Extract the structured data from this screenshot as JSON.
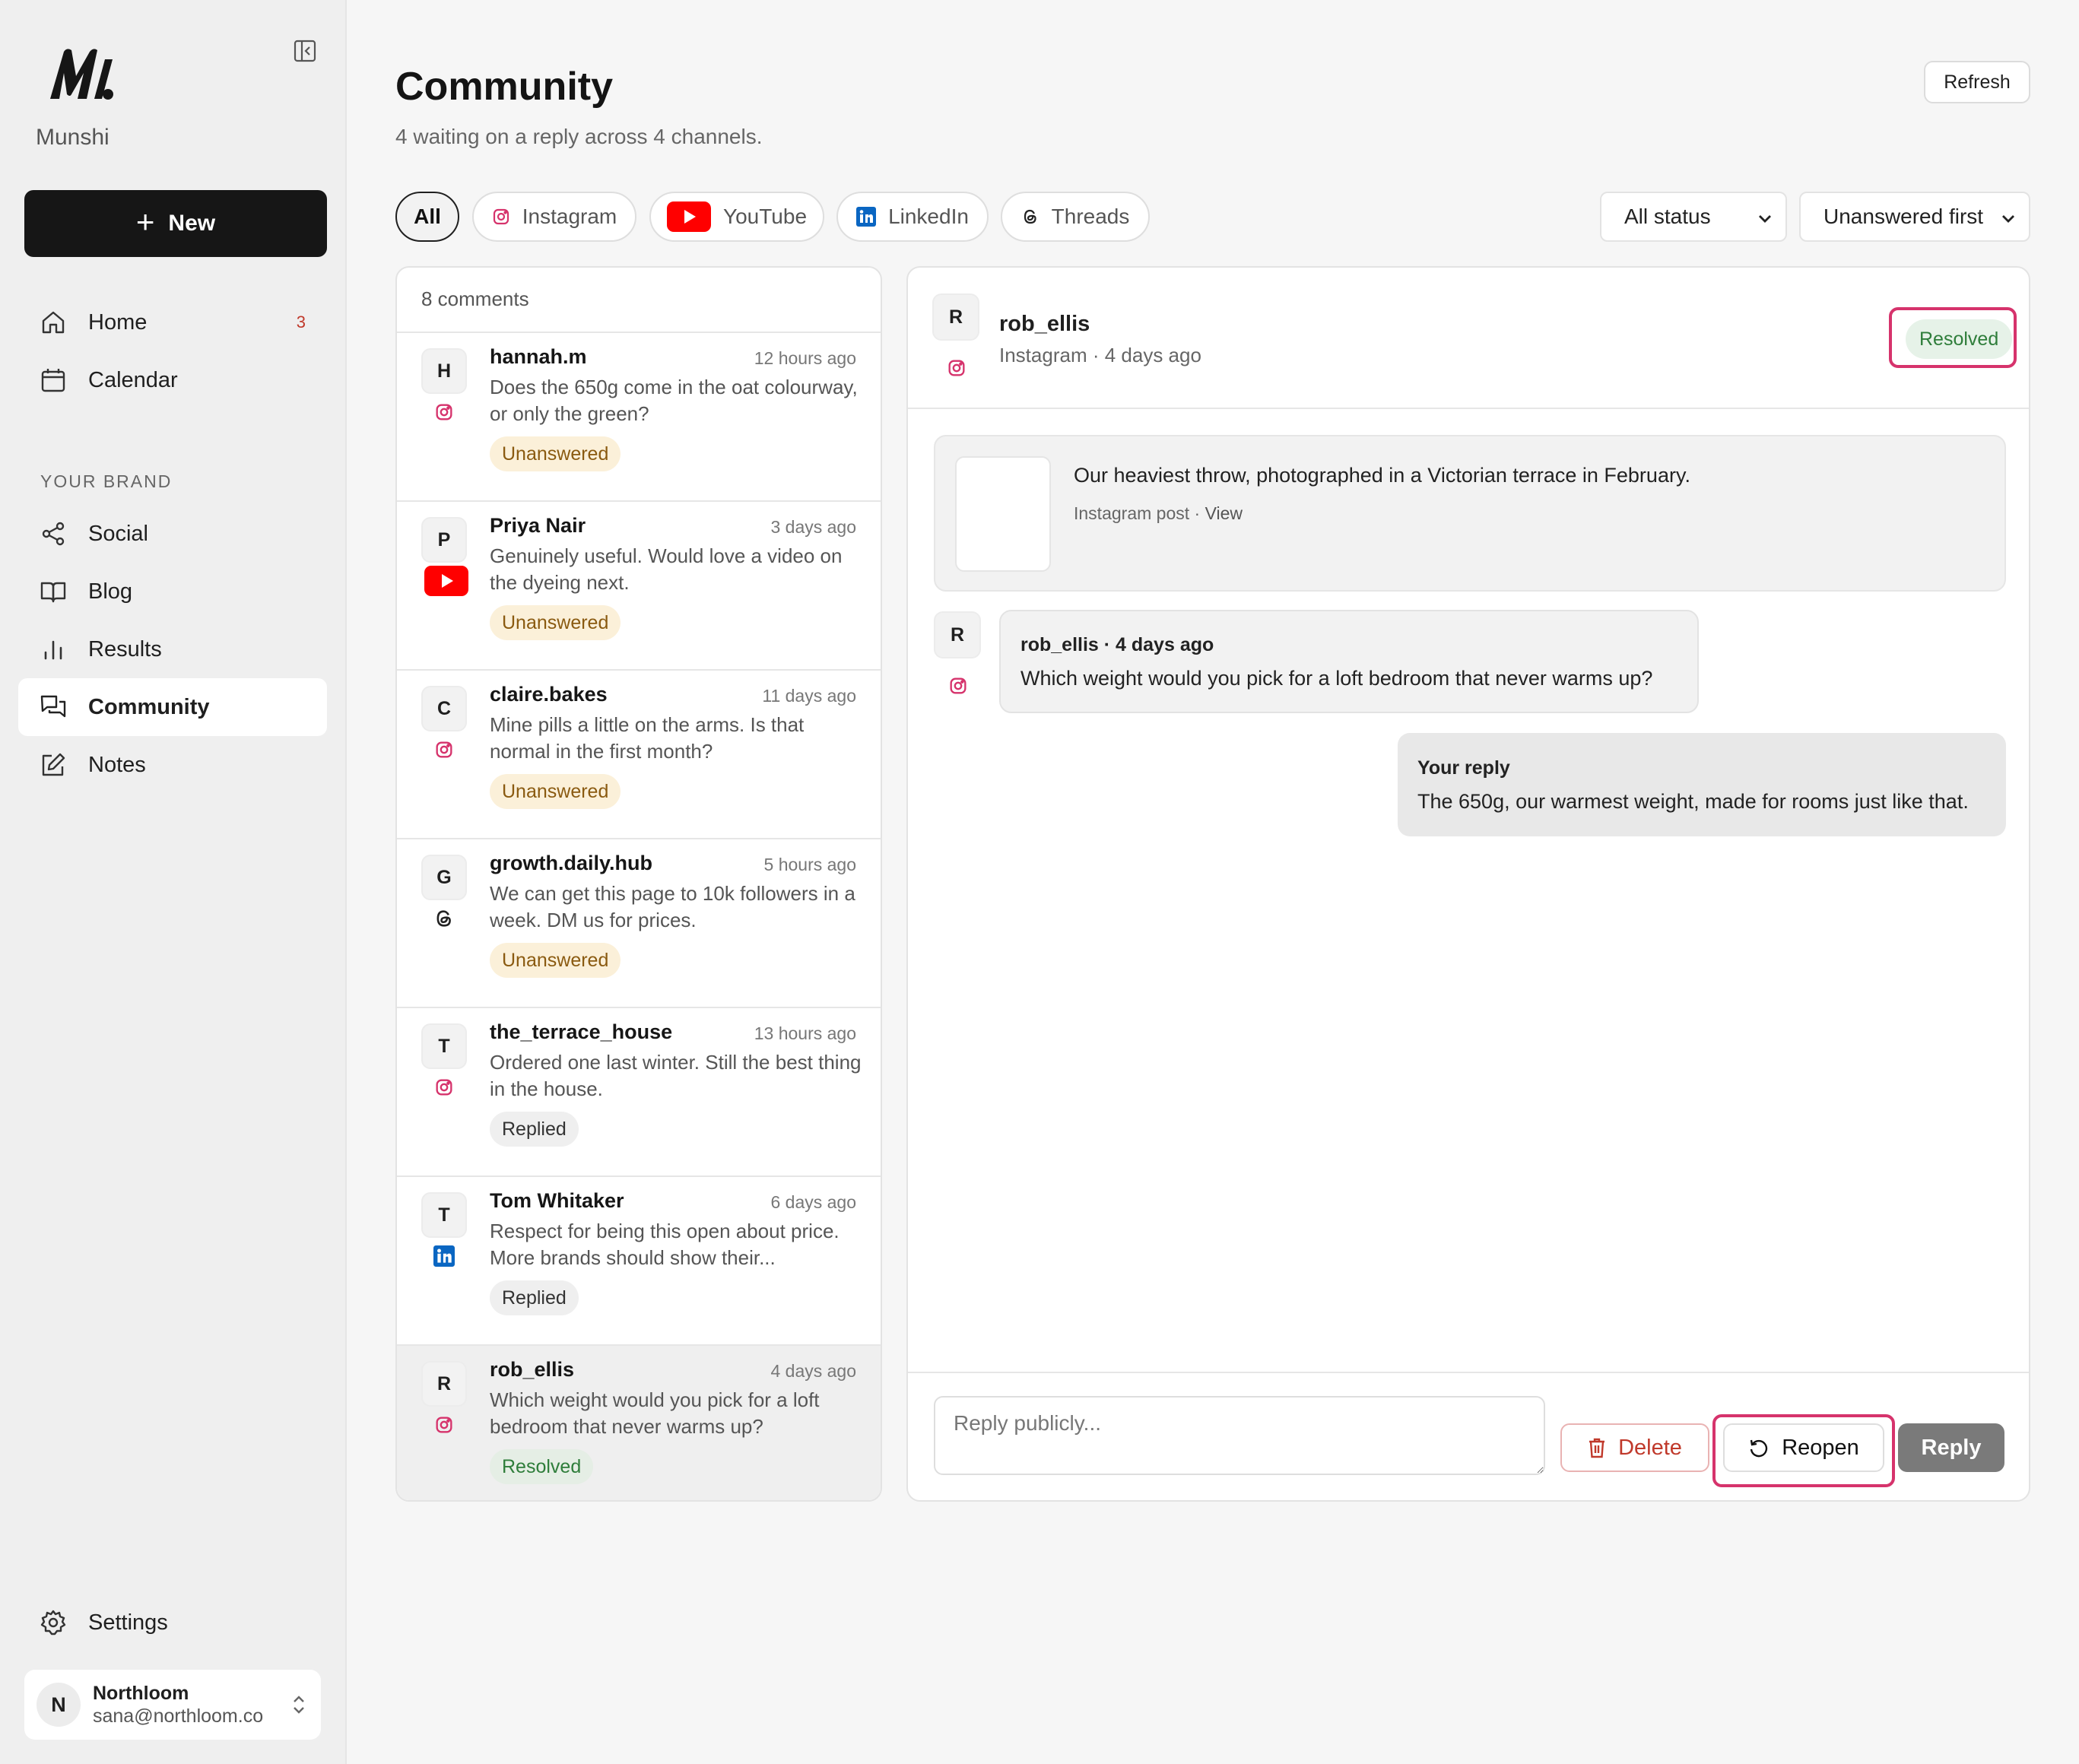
{
  "app": {
    "name": "Munshi",
    "new_label": "New"
  },
  "sidebar": {
    "items": [
      {
        "label": "Home",
        "icon": "home-icon",
        "badge": "3"
      },
      {
        "label": "Calendar",
        "icon": "calendar-icon"
      },
      {
        "label": "Social",
        "icon": "share-icon"
      },
      {
        "label": "Blog",
        "icon": "book-icon"
      },
      {
        "label": "Results",
        "icon": "bar-chart-icon"
      },
      {
        "label": "Community",
        "icon": "chat-icon",
        "active": true
      },
      {
        "label": "Notes",
        "icon": "edit-icon"
      }
    ],
    "section_label": "YOUR BRAND",
    "settings_label": "Settings",
    "account": {
      "initial": "N",
      "name": "Northloom",
      "email": "sana@northloom.co"
    }
  },
  "header": {
    "title": "Community",
    "subtitle": "4 waiting on a reply across 4 channels.",
    "refresh_label": "Refresh"
  },
  "filters": {
    "channels": [
      {
        "label": "All",
        "active": true
      },
      {
        "label": "Instagram",
        "icon": "instagram-icon"
      },
      {
        "label": "YouTube",
        "icon": "youtube-icon"
      },
      {
        "label": "LinkedIn",
        "icon": "linkedin-icon"
      },
      {
        "label": "Threads",
        "icon": "threads-icon"
      }
    ],
    "status_select": "All status",
    "sort_select": "Unanswered first"
  },
  "list": {
    "count_label": "8 comments",
    "items": [
      {
        "initial": "H",
        "name": "hannah.m",
        "time": "12 hours ago",
        "text": "Does the 650g come in the oat colourway, or only the green?",
        "status": "Unanswered",
        "channel": "instagram"
      },
      {
        "initial": "P",
        "name": "Priya Nair",
        "time": "3 days ago",
        "text": "Genuinely useful. Would love a video on the dyeing next.",
        "status": "Unanswered",
        "channel": "youtube"
      },
      {
        "initial": "C",
        "name": "claire.bakes",
        "time": "11 days ago",
        "text": "Mine pills a little on the arms. Is that normal in the first month?",
        "status": "Unanswered",
        "channel": "instagram"
      },
      {
        "initial": "G",
        "name": "growth.daily.hub",
        "time": "5 hours ago",
        "text": "We can get this page to 10k followers in a week. DM us for prices.",
        "status": "Unanswered",
        "channel": "threads"
      },
      {
        "initial": "T",
        "name": "the_terrace_house",
        "time": "13 hours ago",
        "text": "Ordered one last winter. Still the best thing in the house.",
        "status": "Replied",
        "channel": "instagram"
      },
      {
        "initial": "T",
        "name": "Tom Whitaker",
        "time": "6 days ago",
        "text": "Respect for being this open about price. More brands should show their...",
        "status": "Replied",
        "channel": "linkedin"
      },
      {
        "initial": "R",
        "name": "rob_ellis",
        "time": "4 days ago",
        "text": "Which weight would you pick for a loft bedroom that never warms up?",
        "status": "Resolved",
        "channel": "instagram",
        "selected": true
      }
    ]
  },
  "detail": {
    "initial": "R",
    "name": "rob_ellis",
    "meta": "Instagram · 4 days ago",
    "status": "Resolved",
    "post": {
      "text": "Our heaviest throw, photographed in a Victorian terrace in February.",
      "meta": "Instagram post · ",
      "view": "View"
    },
    "comment": {
      "who": "rob_ellis · 4 days ago",
      "text": "Which weight would you pick for a loft bedroom that never warms up?"
    },
    "reply": {
      "who": "Your reply",
      "text": "The 650g, our warmest weight, made for rooms just like that."
    },
    "composer": {
      "placeholder": "Reply publicly...",
      "delete_label": "Delete",
      "reopen_label": "Reopen",
      "reply_label": "Reply"
    }
  },
  "colors": {
    "accent": "#161616",
    "highlight": "#d6336c",
    "unanswered_bg": "#fbf0d9",
    "resolved_text": "#2e7d3a",
    "delete_text": "#c0392b"
  }
}
